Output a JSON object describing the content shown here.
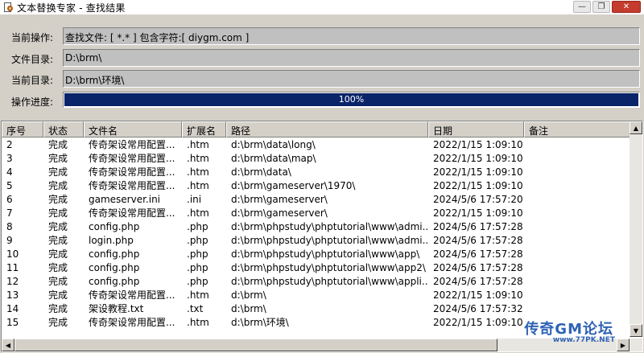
{
  "window": {
    "title": "文本替换专家 - 查找结果",
    "minimize_glyph": "—",
    "maximize_glyph": "❐",
    "close_glyph": "✕"
  },
  "info": {
    "operation_label": "当前操作:",
    "operation_value": "查找文件: [ *.* ]    包含字符:[ diygm.com ]",
    "file_dir_label": "文件目录:",
    "file_dir_value": "D:\\brm\\",
    "current_dir_label": "当前目录:",
    "current_dir_value": "D:\\brm\\环境\\",
    "progress_label": "操作进度:",
    "progress_text": "100%",
    "progress_value": 1.0,
    "progress_color": "#0a246a"
  },
  "table": {
    "columns": [
      "序号",
      "状态",
      "文件名",
      "扩展名",
      "路径",
      "日期",
      "备注"
    ],
    "rows": [
      [
        "2",
        "完成",
        "传奇架设常用配置...",
        ".htm",
        "d:\\brm\\data\\long\\",
        "2022/1/15 1:09:10",
        ""
      ],
      [
        "3",
        "完成",
        "传奇架设常用配置...",
        ".htm",
        "d:\\brm\\data\\map\\",
        "2022/1/15 1:09:10",
        ""
      ],
      [
        "4",
        "完成",
        "传奇架设常用配置...",
        ".htm",
        "d:\\brm\\data\\",
        "2022/1/15 1:09:10",
        ""
      ],
      [
        "5",
        "完成",
        "传奇架设常用配置...",
        ".htm",
        "d:\\brm\\gameserver\\1970\\",
        "2022/1/15 1:09:10",
        ""
      ],
      [
        "6",
        "完成",
        "gameserver.ini",
        ".ini",
        "d:\\brm\\gameserver\\",
        "2024/5/6 17:57:20",
        ""
      ],
      [
        "7",
        "完成",
        "传奇架设常用配置...",
        ".htm",
        "d:\\brm\\gameserver\\",
        "2022/1/15 1:09:10",
        ""
      ],
      [
        "8",
        "完成",
        "config.php",
        ".php",
        "d:\\brm\\phpstudy\\phptutorial\\www\\admi...",
        "2024/5/6 17:57:28",
        ""
      ],
      [
        "9",
        "完成",
        "login.php",
        ".php",
        "d:\\brm\\phpstudy\\phptutorial\\www\\admi...",
        "2024/5/6 17:57:28",
        ""
      ],
      [
        "10",
        "完成",
        "config.php",
        ".php",
        "d:\\brm\\phpstudy\\phptutorial\\www\\app\\",
        "2024/5/6 17:57:28",
        ""
      ],
      [
        "11",
        "完成",
        "config.php",
        ".php",
        "d:\\brm\\phpstudy\\phptutorial\\www\\app2\\",
        "2024/5/6 17:57:28",
        ""
      ],
      [
        "12",
        "完成",
        "config.php",
        ".php",
        "d:\\brm\\phpstudy\\phptutorial\\www\\appli...",
        "2024/5/6 17:57:28",
        ""
      ],
      [
        "13",
        "完成",
        "传奇架设常用配置...",
        ".htm",
        "d:\\brm\\",
        "2022/1/15 1:09:10",
        ""
      ],
      [
        "14",
        "完成",
        "架设教程.txt",
        ".txt",
        "d:\\brm\\",
        "2024/5/6 17:57:32",
        ""
      ],
      [
        "15",
        "完成",
        "传奇架设常用配置...",
        ".htm",
        "d:\\brm\\环境\\",
        "2022/1/15 1:09:10",
        ""
      ]
    ]
  },
  "watermark": {
    "text": "传奇GM论坛",
    "url": "www.77PK.NET"
  },
  "scroll": {
    "up_glyph": "▲",
    "down_glyph": "▼",
    "left_glyph": "◀",
    "right_glyph": "▶"
  }
}
